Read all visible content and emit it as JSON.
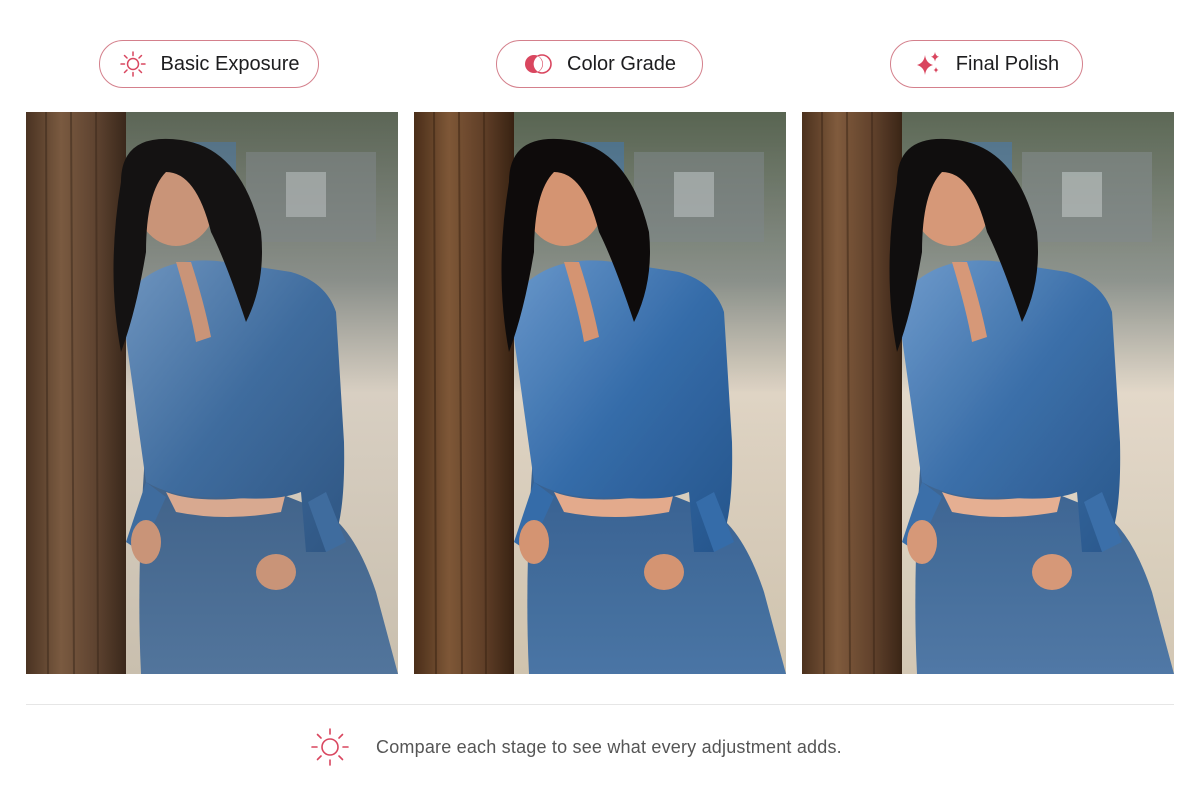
{
  "stages": [
    {
      "label": "Basic Exposure",
      "icon": "sun-icon"
    },
    {
      "label": "Color Grade",
      "icon": "color-circles-icon"
    },
    {
      "label": "Final Polish",
      "icon": "sparkle-icon"
    }
  ],
  "photos": [
    {
      "subject": "woman-in-denim-jacket-leaning-on-wooden-post",
      "variant": "basic-exposure"
    },
    {
      "subject": "woman-in-denim-jacket-leaning-on-wooden-post",
      "variant": "color-grade"
    },
    {
      "subject": "woman-in-denim-jacket-leaning-on-wooden-post",
      "variant": "final-polish"
    }
  ],
  "footer": {
    "icon": "sun-icon",
    "text": "Compare each stage to see what every adjustment adds."
  },
  "colors": {
    "accent": "#d9465f",
    "pill_border": "#d4808c",
    "text": "#1d1d1f",
    "muted_text": "#555555"
  }
}
